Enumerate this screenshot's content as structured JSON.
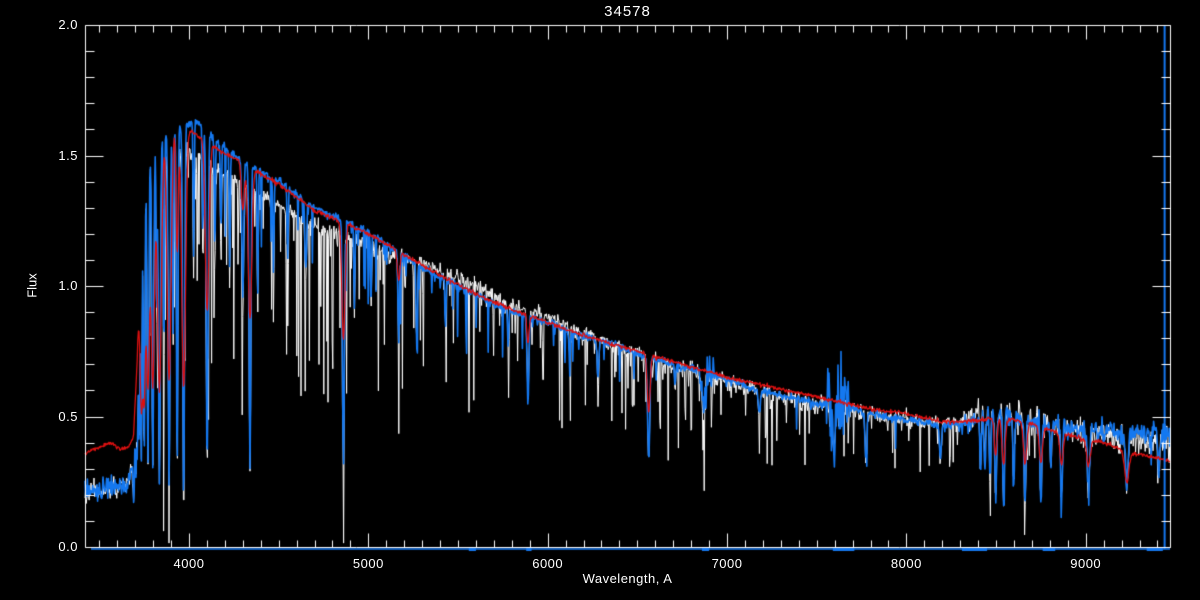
{
  "title": "34578",
  "axes": {
    "xlabel": "Wavelength, A",
    "ylabel": "Flux",
    "xlim": [
      3420,
      9470
    ],
    "ylim": [
      0,
      2
    ],
    "x_major_ticks": [
      {
        "value": 4000,
        "label": "4000"
      },
      {
        "value": 5000,
        "label": "5000"
      },
      {
        "value": 6000,
        "label": "6000"
      },
      {
        "value": 7000,
        "label": "7000"
      },
      {
        "value": 8000,
        "label": "8000"
      },
      {
        "value": 9000,
        "label": "9000"
      }
    ],
    "y_major_ticks": [
      {
        "value": 0.0,
        "label": "0.0"
      },
      {
        "value": 0.5,
        "label": "0.5"
      },
      {
        "value": 1.0,
        "label": "1.0"
      },
      {
        "value": 1.5,
        "label": "1.5"
      },
      {
        "value": 2.0,
        "label": "2.0"
      }
    ],
    "x_minor_step": 100,
    "y_minor_step": 0.1,
    "axis_color": "#ffffff"
  },
  "colors": {
    "background": "#000000",
    "white_spectrum": "#ffffff",
    "blue_spectrum": "#1478f0",
    "red_model": "#dc1010"
  },
  "chart_data": {
    "type": "line",
    "title": "34578",
    "xlabel": "Wavelength, A",
    "ylabel": "Flux",
    "xlim": [
      3420,
      9470
    ],
    "ylim": [
      0,
      2
    ],
    "grid": false,
    "legend": "none",
    "series": [
      {
        "name": "white-observed-spectrum",
        "color": "#ffffff",
        "width": 1.0,
        "seed": 11,
        "continuum": {
          "wl": [
            3420,
            3500,
            3580,
            3650,
            3690,
            3705,
            3720,
            3740,
            3760,
            3790,
            3820,
            3850,
            3890,
            3920,
            3950,
            3980,
            4020,
            4060,
            4100,
            4160,
            4220,
            4300,
            4400,
            4500,
            4600,
            4700,
            4800,
            4900,
            5000,
            5100,
            5200,
            5300,
            5400,
            5500,
            5600,
            5700,
            5800,
            5900,
            6000,
            6100,
            6200,
            6300,
            6400,
            6500,
            6600,
            6700,
            6800,
            6900,
            7000,
            7100,
            7200,
            7300,
            7400,
            7500,
            7600,
            7700,
            7800,
            7900,
            8000,
            8100,
            8200,
            8300,
            8400,
            8500,
            8600,
            8700,
            8800,
            8900,
            9000,
            9100,
            9200,
            9300,
            9400,
            9470
          ],
          "flux": [
            0.21,
            0.22,
            0.23,
            0.24,
            0.3,
            0.55,
            0.95,
            1.3,
            1.45,
            1.52,
            1.55,
            1.57,
            1.59,
            1.6,
            1.61,
            1.62,
            1.63,
            1.62,
            1.59,
            1.55,
            1.52,
            1.48,
            1.44,
            1.4,
            1.35,
            1.3,
            1.27,
            1.24,
            1.21,
            1.16,
            1.12,
            1.07,
            1.03,
            1.0,
            0.97,
            0.93,
            0.9,
            0.88,
            0.86,
            0.83,
            0.81,
            0.79,
            0.77,
            0.74,
            0.72,
            0.7,
            0.68,
            0.66,
            0.64,
            0.62,
            0.6,
            0.58,
            0.57,
            0.55,
            0.54,
            0.53,
            0.51,
            0.5,
            0.49,
            0.48,
            0.47,
            0.47,
            0.49,
            0.51,
            0.5,
            0.48,
            0.47,
            0.46,
            0.45,
            0.45,
            0.44,
            0.44,
            0.43,
            0.43
          ]
        },
        "factor": {
          "wl": [
            3420,
            3700,
            4000,
            4600,
            5100,
            5350,
            5700,
            6100,
            6400,
            6800,
            7600,
            8100,
            8400,
            8700,
            9000,
            9250,
            9470
          ],
          "f": [
            1.0,
            1.0,
            0.93,
            0.94,
            0.97,
            1.03,
            1.04,
            1.02,
            1.0,
            0.99,
            0.99,
            1.0,
            1.04,
            1.01,
            0.97,
            0.95,
            0.95
          ]
        },
        "noise": {
          "wl": [
            3420,
            3690,
            3700,
            7000,
            7560,
            7660,
            8300,
            8350,
            9470
          ],
          "sigma": [
            0.02,
            0.02,
            0.014,
            0.014,
            0.02,
            0.016,
            0.016,
            0.026,
            0.03
          ]
        },
        "spikes": {
          "wl": [
            3420,
            3740,
            3750,
            7000,
            7050,
            9470
          ],
          "p": [
            0,
            0,
            0.22,
            0.22,
            0.12,
            0.1
          ],
          "base_depth": 0.03,
          "max_extra_depth": 0.5
        },
        "lines_ref": "absorption_lines"
      },
      {
        "name": "blue-smoothed-spectrum",
        "color": "#1478f0",
        "width": 1.6,
        "seed": 23,
        "continuum": {
          "wl": [
            3420,
            3500,
            3580,
            3650,
            3690,
            3705,
            3720,
            3740,
            3760,
            3790,
            3820,
            3850,
            3890,
            3920,
            3950,
            3980,
            4020,
            4060,
            4100,
            4160,
            4220,
            4300,
            4400,
            4500,
            4600,
            4700,
            4800,
            4900,
            5000,
            5100,
            5200,
            5300,
            5400,
            5500,
            5600,
            5700,
            5800,
            5900,
            6000,
            6100,
            6200,
            6300,
            6400,
            6500,
            6600,
            6700,
            6800,
            6900,
            7000,
            7100,
            7200,
            7300,
            7400,
            7500,
            7600,
            7700,
            7800,
            7900,
            8000,
            8100,
            8200,
            8300,
            8400,
            8500,
            8600,
            8700,
            8800,
            8900,
            9000,
            9100,
            9200,
            9300,
            9400,
            9470
          ],
          "flux": [
            0.21,
            0.22,
            0.23,
            0.24,
            0.3,
            0.55,
            0.95,
            1.3,
            1.45,
            1.52,
            1.55,
            1.57,
            1.59,
            1.6,
            1.61,
            1.62,
            1.63,
            1.62,
            1.59,
            1.55,
            1.52,
            1.48,
            1.44,
            1.4,
            1.35,
            1.3,
            1.27,
            1.24,
            1.21,
            1.16,
            1.12,
            1.07,
            1.03,
            1.0,
            0.97,
            0.93,
            0.9,
            0.88,
            0.86,
            0.83,
            0.81,
            0.79,
            0.77,
            0.74,
            0.72,
            0.7,
            0.68,
            0.66,
            0.64,
            0.62,
            0.6,
            0.58,
            0.57,
            0.55,
            0.54,
            0.53,
            0.51,
            0.5,
            0.49,
            0.48,
            0.47,
            0.47,
            0.49,
            0.51,
            0.5,
            0.48,
            0.47,
            0.46,
            0.45,
            0.45,
            0.44,
            0.44,
            0.43,
            0.43
          ]
        },
        "noise": {
          "wl": [
            3420,
            3690,
            3700,
            6840,
            6860,
            6920,
            6940,
            7540,
            7560,
            7660,
            7690,
            8300,
            8350,
            9350,
            9470
          ],
          "sigma": [
            0.022,
            0.022,
            0.007,
            0.007,
            0.038,
            0.038,
            0.007,
            0.007,
            0.085,
            0.085,
            0.008,
            0.008,
            0.022,
            0.022,
            0.028
          ]
        },
        "spikes": {
          "wl": [
            3420,
            4100,
            4150,
            7000,
            7050,
            9470
          ],
          "p": [
            0,
            0,
            0.05,
            0.05,
            0.03,
            0.05
          ],
          "base_depth": 0.02,
          "max_extra_depth": 0.25
        },
        "lines_ref": "absorption_lines"
      },
      {
        "name": "red-model-fit",
        "color": "#dc1010",
        "width": 1.3,
        "seed": 5,
        "continuum": {
          "wl": [
            3420,
            3500,
            3560,
            3620,
            3660,
            3690,
            3710,
            3730,
            3760,
            3800,
            3850,
            3900,
            3950,
            4000,
            4060,
            4120,
            4200,
            4300,
            4400,
            4500,
            4600,
            4700,
            4800,
            4900,
            5000,
            5200,
            5400,
            5600,
            5800,
            6000,
            6200,
            6400,
            6600,
            6800,
            7000,
            7200,
            7400,
            7600,
            7800,
            8000,
            8200,
            8350,
            8500,
            8650,
            8800,
            8950,
            9100,
            9250,
            9400,
            9470
          ],
          "flux": [
            0.36,
            0.38,
            0.4,
            0.375,
            0.38,
            0.42,
            0.7,
            1.2,
            1.45,
            1.54,
            1.58,
            1.6,
            1.62,
            1.6,
            1.57,
            1.54,
            1.51,
            1.47,
            1.43,
            1.39,
            1.34,
            1.29,
            1.26,
            1.23,
            1.2,
            1.12,
            1.04,
            0.97,
            0.91,
            0.86,
            0.81,
            0.77,
            0.73,
            0.69,
            0.65,
            0.62,
            0.59,
            0.56,
            0.53,
            0.51,
            0.48,
            0.48,
            0.5,
            0.48,
            0.45,
            0.42,
            0.4,
            0.36,
            0.34,
            0.33
          ]
        },
        "noise": {
          "wl": [
            3420,
            9470
          ],
          "sigma": [
            0.004,
            0.004
          ]
        },
        "lines_ref": "model_lines"
      }
    ],
    "absorption_lines": [
      [
        3692,
        0.45,
        3
      ],
      [
        3704,
        0.5,
        3
      ],
      [
        3712,
        0.52,
        3
      ],
      [
        3722,
        0.58,
        3.5
      ],
      [
        3734,
        0.72,
        4
      ],
      [
        3750,
        0.75,
        4
      ],
      [
        3771,
        0.78,
        4.5
      ],
      [
        3798,
        0.8,
        5
      ],
      [
        3820,
        0.45,
        3
      ],
      [
        3835,
        0.84,
        5
      ],
      [
        3860,
        0.55,
        3
      ],
      [
        3889,
        0.86,
        5
      ],
      [
        3911,
        0.5,
        3
      ],
      [
        3934,
        0.82,
        4
      ],
      [
        3970,
        0.9,
        5
      ],
      [
        4026,
        0.32,
        3
      ],
      [
        4077,
        0.26,
        3
      ],
      [
        4101,
        0.8,
        5
      ],
      [
        4144,
        0.28,
        3
      ],
      [
        4178,
        0.22,
        3
      ],
      [
        4227,
        0.3,
        3
      ],
      [
        4300,
        0.35,
        5
      ],
      [
        4340,
        0.79,
        5
      ],
      [
        4383,
        0.33,
        3
      ],
      [
        4471,
        0.26,
        3
      ],
      [
        4550,
        0.2,
        3
      ],
      [
        4650,
        0.2,
        4
      ],
      [
        4861,
        0.76,
        5
      ],
      [
        4922,
        0.26,
        3
      ],
      [
        5015,
        0.22,
        3
      ],
      [
        5169,
        0.3,
        4
      ],
      [
        5270,
        0.28,
        4
      ],
      [
        5430,
        0.18,
        3
      ],
      [
        5780,
        0.15,
        3
      ],
      [
        5890,
        0.38,
        5
      ],
      [
        6122,
        0.15,
        3
      ],
      [
        6280,
        0.18,
        5
      ],
      [
        6563,
        0.54,
        6
      ],
      [
        6710,
        0.12,
        3
      ],
      [
        6867,
        0.26,
        7
      ],
      [
        7180,
        0.16,
        6
      ],
      [
        7594,
        0.3,
        9
      ],
      [
        7774,
        0.35,
        5
      ],
      [
        8190,
        0.28,
        6
      ],
      [
        8413,
        0.42,
        4
      ],
      [
        8438,
        0.46,
        4
      ],
      [
        8467,
        0.5,
        4
      ],
      [
        8498,
        0.64,
        5
      ],
      [
        8542,
        0.7,
        5
      ],
      [
        8598,
        0.56,
        4
      ],
      [
        8662,
        0.68,
        5
      ],
      [
        8750,
        0.62,
        5
      ],
      [
        8806,
        0.36,
        4
      ],
      [
        8865,
        0.6,
        5
      ],
      [
        9015,
        0.54,
        6
      ],
      [
        9229,
        0.5,
        7
      ],
      [
        9406,
        0.3,
        5
      ]
    ],
    "model_lines": [
      [
        3734,
        0.55,
        8
      ],
      [
        3750,
        0.56,
        8
      ],
      [
        3771,
        0.58,
        9
      ],
      [
        3798,
        0.6,
        10
      ],
      [
        3835,
        0.62,
        11
      ],
      [
        3889,
        0.6,
        11
      ],
      [
        3934,
        0.3,
        6
      ],
      [
        3970,
        0.62,
        11
      ],
      [
        4101,
        0.42,
        10
      ],
      [
        4300,
        0.12,
        8
      ],
      [
        4340,
        0.4,
        10
      ],
      [
        4861,
        0.36,
        9
      ],
      [
        5169,
        0.1,
        7
      ],
      [
        5890,
        0.12,
        6
      ],
      [
        6563,
        0.3,
        8
      ],
      [
        8498,
        0.3,
        8
      ],
      [
        8542,
        0.36,
        9
      ],
      [
        8662,
        0.34,
        9
      ],
      [
        8750,
        0.3,
        9
      ],
      [
        8865,
        0.28,
        9
      ],
      [
        9015,
        0.25,
        10
      ],
      [
        9229,
        0.32,
        12
      ]
    ],
    "zero_line": {
      "color": "#1478f0",
      "flux": 0.0,
      "thick_ranges": [
        [
          5560,
          5600
        ],
        [
          5880,
          5910
        ],
        [
          6860,
          6900
        ],
        [
          7590,
          7710
        ],
        [
          8310,
          8450
        ],
        [
          8760,
          8830
        ],
        [
          9340,
          9430
        ]
      ]
    },
    "edge_spike": {
      "color": "#1478f0",
      "wavelength": 9440,
      "flux_min": 0.0,
      "flux_max": 2.0
    }
  }
}
